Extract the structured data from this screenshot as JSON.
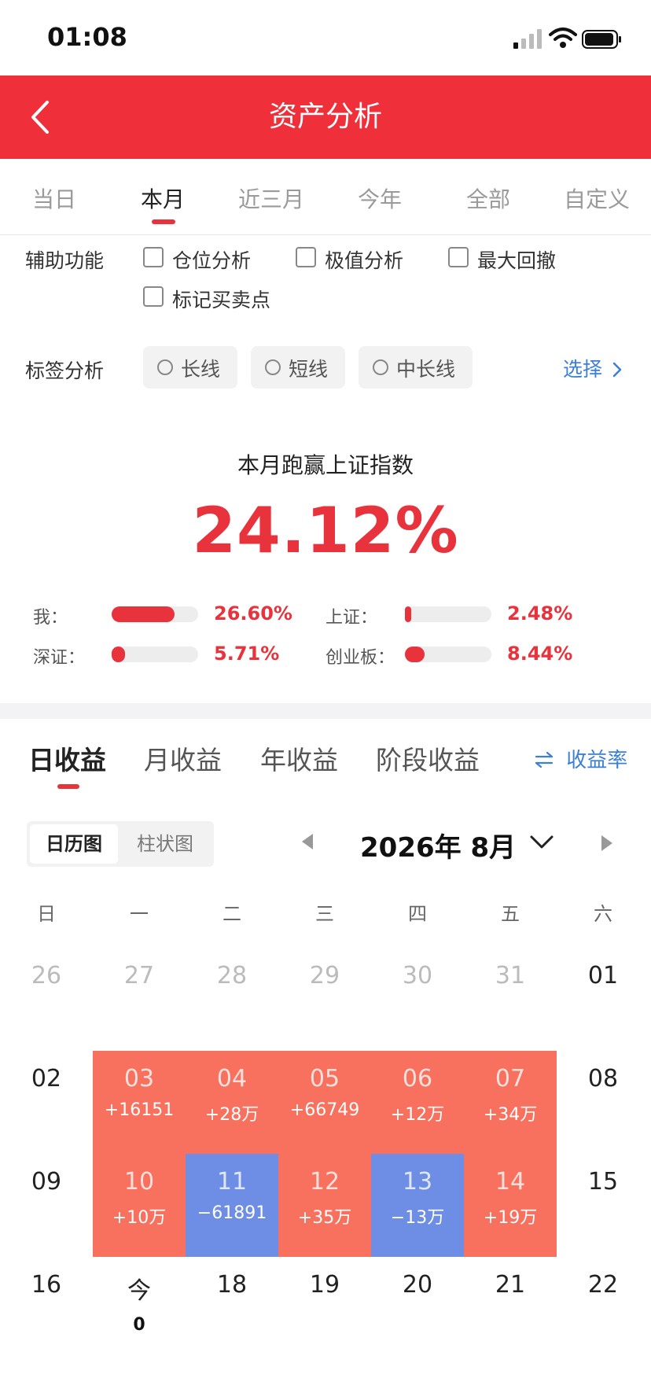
{
  "status": {
    "time": "01:08"
  },
  "header": {
    "title": "资产分析"
  },
  "period_tabs": [
    "当日",
    "本月",
    "近三月",
    "今年",
    "全部",
    "自定义"
  ],
  "period_active": "本月",
  "aux": {
    "label": "辅助功能",
    "options": [
      "仓位分析",
      "极值分析",
      "最大回撤",
      "标记买卖点"
    ]
  },
  "tags": {
    "label": "标签分析",
    "options": [
      "长线",
      "短线",
      "中长线"
    ],
    "select": "选择"
  },
  "performance": {
    "title": "本月跑赢上证指数",
    "value": "24.12%",
    "comparisons": [
      {
        "label": "我：",
        "pct": "26.60%",
        "level": 0.266
      },
      {
        "label": "上证：",
        "pct": "2.48%",
        "level": 0.025
      },
      {
        "label": "深证：",
        "pct": "5.71%",
        "level": 0.057
      },
      {
        "label": "创业板：",
        "pct": "8.44%",
        "level": 0.084
      }
    ]
  },
  "income_tabs": [
    "日收益",
    "月收益",
    "年收益",
    "阶段收益"
  ],
  "income_active": "日收益",
  "rate_link": "收益率",
  "view_toggle": [
    "日历图",
    "柱状图"
  ],
  "month_label": "2026年 8月",
  "weekdays": [
    "日",
    "一",
    "二",
    "三",
    "四",
    "五",
    "六"
  ],
  "calendar_rows": [
    [
      {
        "d": "26",
        "t": "other"
      },
      {
        "d": "27",
        "t": "other"
      },
      {
        "d": "28",
        "t": "other"
      },
      {
        "d": "29",
        "t": "other"
      },
      {
        "d": "30",
        "t": "other"
      },
      {
        "d": "31",
        "t": "other"
      },
      {
        "d": "01",
        "t": "normal"
      }
    ],
    [
      {
        "d": "02",
        "t": "normal"
      },
      {
        "d": "03",
        "t": "gain",
        "v": "+16151"
      },
      {
        "d": "04",
        "t": "gain",
        "v": "+28万"
      },
      {
        "d": "05",
        "t": "gain",
        "v": "+66749"
      },
      {
        "d": "06",
        "t": "gain",
        "v": "+12万"
      },
      {
        "d": "07",
        "t": "gain",
        "v": "+34万"
      },
      {
        "d": "08",
        "t": "normal"
      }
    ],
    [
      {
        "d": "09",
        "t": "normal"
      },
      {
        "d": "10",
        "t": "gain",
        "v": "+10万"
      },
      {
        "d": "11",
        "t": "loss",
        "v": "−61891"
      },
      {
        "d": "12",
        "t": "gain",
        "v": "+35万"
      },
      {
        "d": "13",
        "t": "loss",
        "v": "−13万"
      },
      {
        "d": "14",
        "t": "gain",
        "v": "+19万"
      },
      {
        "d": "15",
        "t": "normal"
      }
    ],
    [
      {
        "d": "16",
        "t": "normal"
      },
      {
        "d": "今",
        "t": "today",
        "v": "0"
      },
      {
        "d": "18",
        "t": "normal"
      },
      {
        "d": "19",
        "t": "normal"
      },
      {
        "d": "20",
        "t": "normal"
      },
      {
        "d": "21",
        "t": "normal"
      },
      {
        "d": "22",
        "t": "normal"
      }
    ]
  ],
  "colors": {
    "brand": "#ef2f3a",
    "gain": "#f7715e",
    "loss": "#6d8ee4",
    "link": "#3b7fd6"
  }
}
